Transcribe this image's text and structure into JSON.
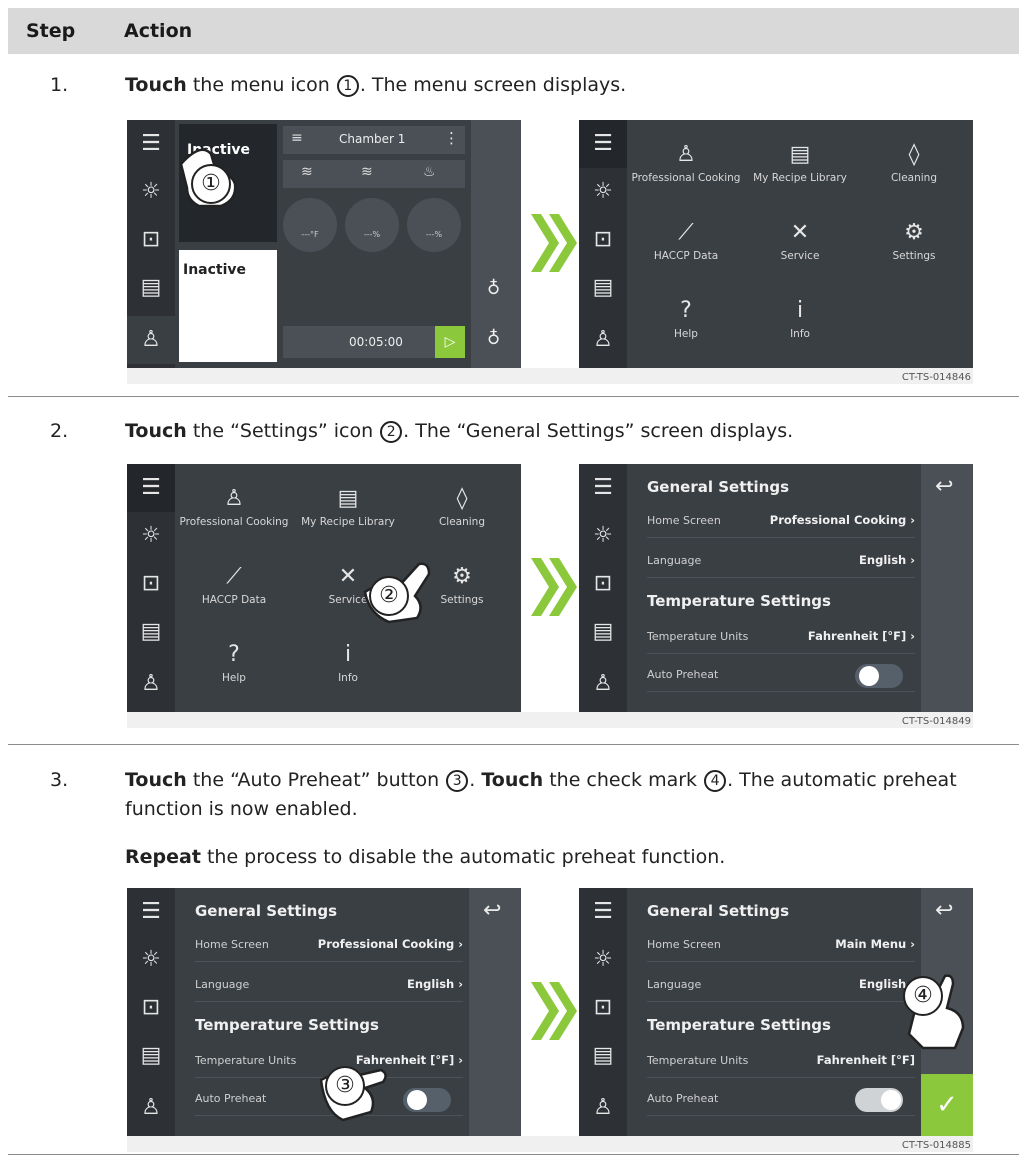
{
  "table_header": {
    "step": "Step",
    "action": "Action"
  },
  "steps": [
    {
      "number": "1.",
      "parts": [
        "Touch",
        " the menu icon ",
        "1",
        ". The menu screen displays."
      ],
      "figure_id": "CT-TS-014846",
      "callout": "①"
    },
    {
      "number": "2.",
      "parts": [
        "Touch",
        " the “Settings” icon ",
        "2",
        ". The “General Settings” screen displays."
      ],
      "figure_id": "CT-TS-014849",
      "callout": "②"
    },
    {
      "number": "3.",
      "parts": [
        "Touch",
        " the “Auto Preheat” button ",
        "3",
        ". ",
        "Touch",
        " the check mark ",
        "4",
        ". The automatic preheat function is now enabled."
      ],
      "repeat_parts": [
        "Repeat",
        " the process to disable the automatic preheat function."
      ],
      "figure_id": "CT-TS-014885",
      "callouts": [
        "③",
        "④"
      ]
    }
  ],
  "home_screen": {
    "chamber_label": "Chamber 1",
    "inactive_top": "Inactive",
    "inactive_bottom": "Inactive",
    "temp": "---°F",
    "fan": "---%",
    "humidity": "---%",
    "timer": "00:05:00"
  },
  "menu": {
    "items": [
      {
        "label": "Professional Cooking",
        "icon": "chef-icon",
        "glyph": "♙"
      },
      {
        "label": "My Recipe Library",
        "icon": "recipe-book-icon",
        "glyph": "▤"
      },
      {
        "label": "Cleaning",
        "icon": "droplet-icon",
        "glyph": "◊"
      },
      {
        "label": "HACCP Data",
        "icon": "chart-icon",
        "glyph": "⟋"
      },
      {
        "label": "Service",
        "icon": "tools-icon",
        "glyph": "✕"
      },
      {
        "label": "Settings",
        "icon": "gear-icon",
        "glyph": "⚙"
      },
      {
        "label": "Help",
        "icon": "help-icon",
        "glyph": "?"
      },
      {
        "label": "Info",
        "icon": "info-icon",
        "glyph": "i"
      }
    ]
  },
  "settings": {
    "general_title": "General Settings",
    "home_screen_label": "Home Screen",
    "home_screen_value": "Professional Cooking",
    "home_screen_value_after": "Main Menu",
    "language_label": "Language",
    "language_value": "English",
    "temperature_title": "Temperature Settings",
    "temp_units_label": "Temperature Units",
    "temp_units_value": "Fahrenheit [°F]",
    "auto_preheat_label": "Auto Preheat"
  },
  "colors": {
    "screen_bg": "#3a3f44",
    "sidebar_bg": "#2d3136",
    "accent_green": "#8cc83c"
  }
}
